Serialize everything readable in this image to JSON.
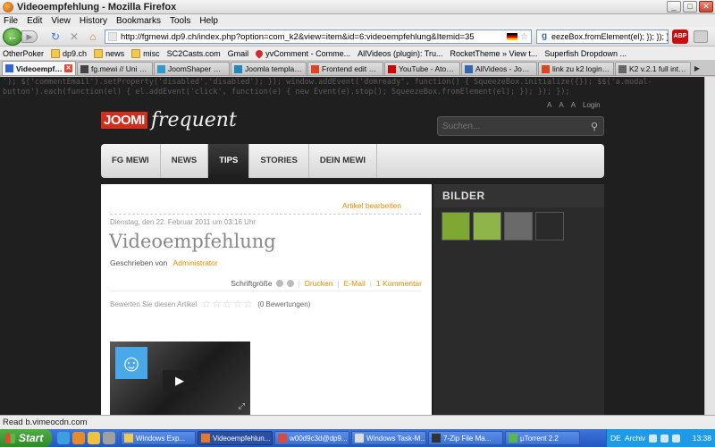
{
  "window": {
    "title": "Videoempfehlung - Mozilla Firefox",
    "buttons": [
      "_",
      "□",
      "✕"
    ]
  },
  "menu": [
    "File",
    "Edit",
    "View",
    "History",
    "Bookmarks",
    "Tools",
    "Help"
  ],
  "navbar": {
    "url": "http://fgmewi.dp9.ch/index.php?option=com_k2&view=item&id=6:videoempfehlung&Itemid=35",
    "search_value": "eezeBox.fromElement(el); }); }); });$",
    "search_engine": "g",
    "adblock_label": "ABP"
  },
  "bookmarks": [
    {
      "label": "OtherPoker",
      "icon": "page"
    },
    {
      "label": "dp9.ch",
      "icon": "folder"
    },
    {
      "label": "news",
      "icon": "folder"
    },
    {
      "label": "misc",
      "icon": "folder"
    },
    {
      "label": "SC2Casts.com",
      "icon": "page"
    },
    {
      "label": "Gmail",
      "icon": "page"
    },
    {
      "label": "yvComment - Comme...",
      "icon": "heart"
    },
    {
      "label": "AllVideos (plugin): Tru...",
      "icon": "page"
    },
    {
      "label": "RocketTheme » View t...",
      "icon": "page"
    },
    {
      "label": "Superfish Dropdown ...",
      "icon": "page"
    }
  ],
  "tabs": [
    {
      "label": "Videoempfe...",
      "active": true,
      "color": "#3366cc"
    },
    {
      "label": "fg.mewi // Uni Basel...",
      "active": false,
      "color": "#444444"
    },
    {
      "label": "JoomShaper Demo ...",
      "active": false,
      "color": "#3399cc"
    },
    {
      "label": "Joomla template clu...",
      "active": false,
      "color": "#2288bb"
    },
    {
      "label": "Frontend edit k2 ite...",
      "active": false,
      "color": "#dd4422"
    },
    {
      "label": "YouTube - Atomica-...",
      "active": false,
      "color": "#cc0000"
    },
    {
      "label": "AllVideos - Joomla!...",
      "active": false,
      "color": "#3366aa"
    },
    {
      "label": "link zu k2 login - Go...",
      "active": false,
      "color": "#dd4422"
    },
    {
      "label": "K2 v.2.1 full integra...",
      "active": false,
      "color": "#666666"
    }
  ],
  "page": {
    "js_leak": "'); $('commentEmail').setProperty('disabled','disabled'); }); window.addEvent('domready', function() { SqueezeBox.initialize({}); $$('a.modal-button').each(function(el) { el.addEvent('click', function(e) { new Event(e).stop(); SqueezeBox.fromElement(el); }); }); });",
    "logo_box": "JOOMI",
    "logo_script": "frequent",
    "top_links": [
      "A",
      "A",
      "A",
      "Login"
    ],
    "search_placeholder": "Suchen...",
    "nav": [
      {
        "label": "FG MEWI",
        "active": false
      },
      {
        "label": "NEWS",
        "active": false
      },
      {
        "label": "TIPS",
        "active": true
      },
      {
        "label": "STORIES",
        "active": false
      },
      {
        "label": "DEIN MEWI",
        "active": false
      }
    ],
    "article": {
      "edit_link": "Artikel bearbeiten",
      "date": "Dienstag, den 22. Februar 2011 um 03:16 Uhr",
      "title": "Videoempfehlung",
      "author_prefix": "Geschrieben von",
      "author": "Administrator",
      "font_size_label": "Schriftgröße",
      "print": "Drucken",
      "email": "E-Mail",
      "comments": "1 Kommentar",
      "rate_label": "Bewerten Sie diesen Artikel",
      "stars": "☆☆☆☆☆",
      "rating_count": "(0 Bewertungen)"
    },
    "sidebar": {
      "heading": "BILDER",
      "thumb_colors": [
        "#7fa832",
        "#8fb54a",
        "#6a6a6a",
        "#2a2a2a"
      ]
    }
  },
  "status": "Read b.vimeocdn.com",
  "taskbar": {
    "start": "Start",
    "quick_colors": [
      "#3ca0e0",
      "#e88a2a",
      "#f0c040",
      "#a0a0a0"
    ],
    "tasks": [
      {
        "label": "Windows Exp...",
        "active": false,
        "color": "#f2c94c"
      },
      {
        "label": "Videoempfehlun...",
        "active": true,
        "color": "#e8762a"
      },
      {
        "label": "w00d9c3d@dp9...",
        "active": false,
        "color": "#d84a3a"
      },
      {
        "label": "Windows Task-M...",
        "active": false,
        "color": "#dddddd"
      },
      {
        "label": "7-Zip File Ma...",
        "active": false,
        "color": "#333333"
      },
      {
        "label": "µTorrent 2.2",
        "active": false,
        "color": "#58b84a"
      }
    ],
    "tray": {
      "lang": "DE",
      "archiv": "Archiv",
      "clock": "13:38"
    }
  }
}
